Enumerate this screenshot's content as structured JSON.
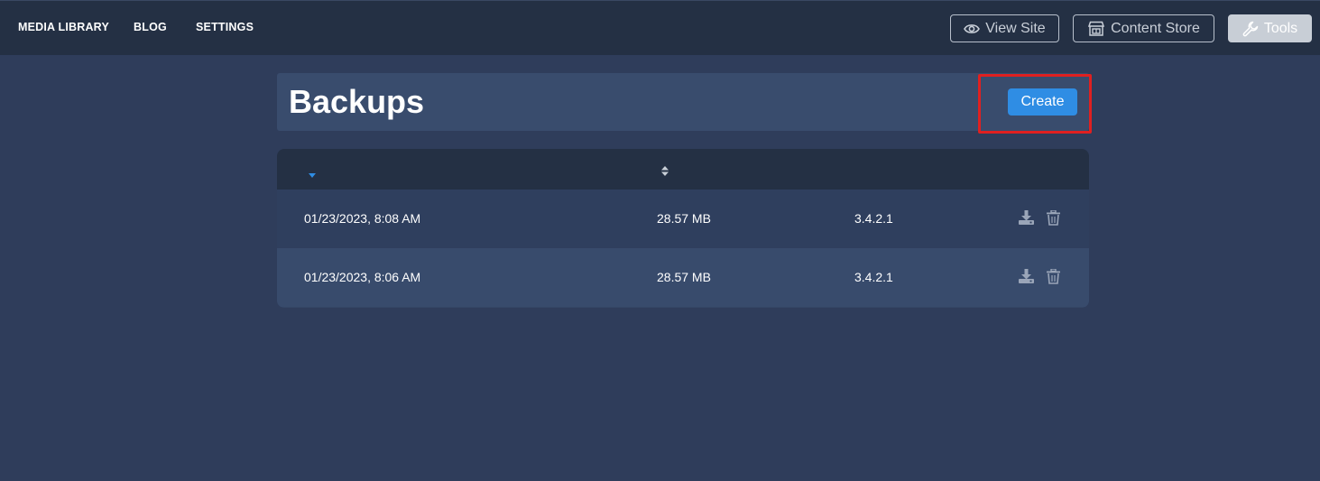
{
  "nav": {
    "items": [
      {
        "label": "MEDIA LIBRARY"
      },
      {
        "label": "BLOG"
      },
      {
        "label": "SETTINGS"
      }
    ]
  },
  "toolbar": {
    "view_site_label": "View Site",
    "content_store_label": "Content Store",
    "tools_label": "Tools"
  },
  "header": {
    "title": "Backups",
    "create_label": "Create"
  },
  "table": {
    "rows": [
      {
        "date": "01/23/2023, 8:08 AM",
        "size": "28.57 MB",
        "version": "3.4.2.1"
      },
      {
        "date": "01/23/2023, 8:06 AM",
        "size": "28.57 MB",
        "version": "3.4.2.1"
      }
    ]
  },
  "colors": {
    "background": "#2f3d5b",
    "topbar": "#243044",
    "accent": "#2f8de4",
    "highlight": "#e02020"
  }
}
